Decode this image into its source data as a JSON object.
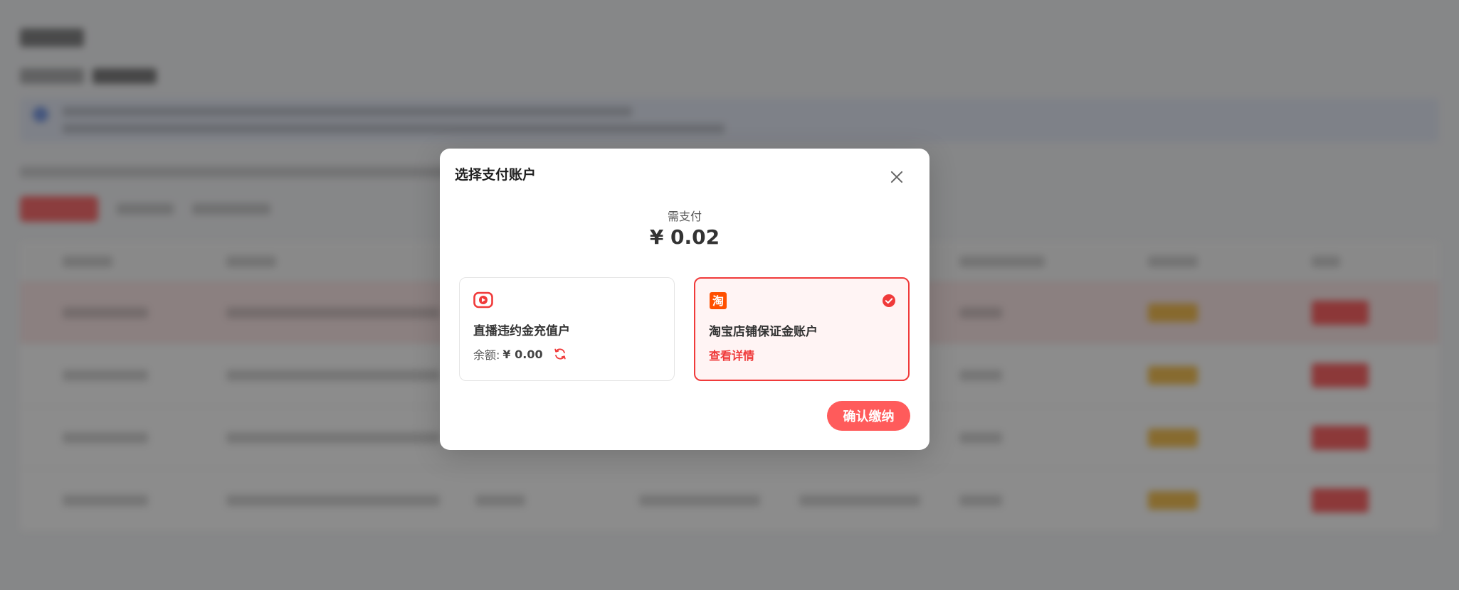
{
  "modal": {
    "title": "选择支付账户",
    "pay_label": "需支付",
    "pay_amount": "¥ 0.02",
    "confirm_label": "确认缴纳"
  },
  "accounts": [
    {
      "name": "直播违约金充值户",
      "icon": "live-play-icon",
      "balance_label": "余额:",
      "balance_value": "¥ 0.00",
      "selected": false
    },
    {
      "name": "淘宝店铺保证金账户",
      "icon": "taobao-logo-icon",
      "logo_char": "淘",
      "detail_label": "查看详情",
      "selected": true
    }
  ],
  "colors": {
    "accent": "#f03a3a",
    "confirm_button": "#ff5b5b",
    "taobao_orange": "#ff5000",
    "selected_card_bg": "#fff4f4"
  }
}
